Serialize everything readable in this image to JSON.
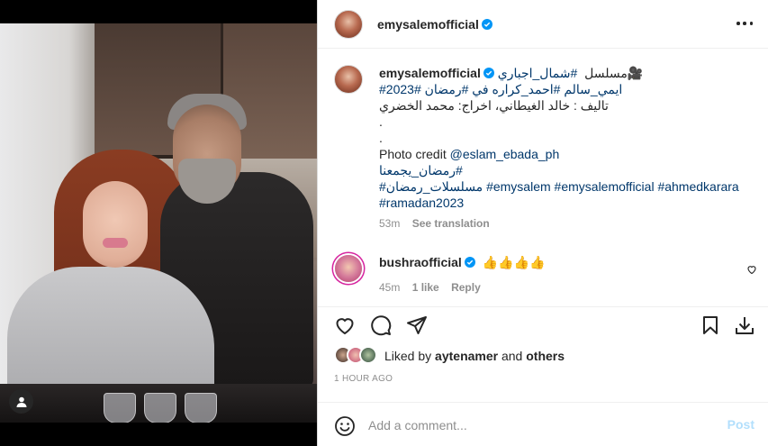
{
  "post": {
    "author": "emysalemofficial",
    "verified": true
  },
  "caption": {
    "author": "emysalemofficial",
    "line1_text": "مسلسل ",
    "line1_tag": "#شمال_اجباري",
    "line1_emoji": "🎥",
    "line2_tags": "ايمي_سالم #احمد_كراره في #رمضان #2023#",
    "line3": "تاليف : خالد الغيطاني، اخراج: محمد الخضري",
    "dot1": ".",
    "dot2": ".",
    "photo_credit_label": "Photo credit ",
    "photo_credit_handle": "@eslam_ebada_ph",
    "line7": "#رمضان_يجمعنا",
    "line8": "#مسلسلات_رمضان #emysalem #emysalemofficial #ahmedkarara",
    "line9": "#ramadan2023",
    "age": "53m",
    "see_translation": "See translation"
  },
  "comment": {
    "author": "bushraofficial",
    "text": "👍👍👍👍",
    "age": "45m",
    "likes": "1 like",
    "reply": "Reply"
  },
  "likes": {
    "prefix": "Liked by ",
    "user": "aytenamer",
    "and": " and ",
    "others": "others"
  },
  "timestamp": "1 HOUR AGO",
  "add_comment": {
    "placeholder": "Add a comment...",
    "post_label": "Post"
  },
  "colors": {
    "verified_blue": "#0095f6",
    "hashtag": "#00376b",
    "secondary_text": "#8e8e8e",
    "post_disabled": "#b2dffc"
  }
}
